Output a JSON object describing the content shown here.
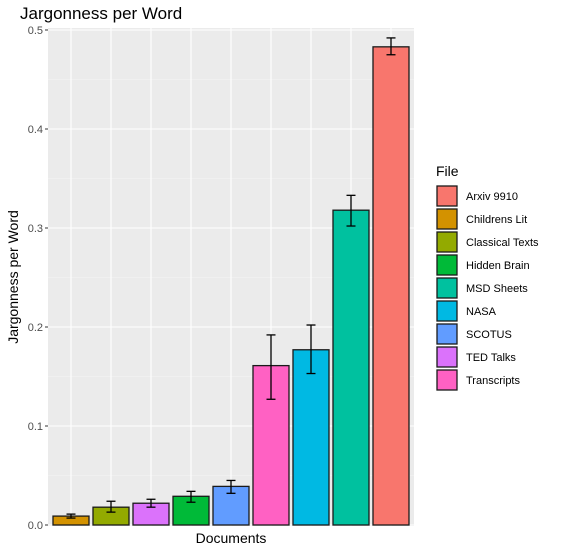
{
  "chart_data": {
    "type": "bar",
    "title": "Jargonness per Word",
    "xlabel": "Documents",
    "ylabel": "Jargonness per Word",
    "ylim": [
      0,
      0.5
    ],
    "y_ticks": [
      0.0,
      0.1,
      0.2,
      0.3,
      0.4,
      0.5
    ],
    "y_tick_labels": [
      "0.0",
      "0.1",
      "0.2",
      "0.3",
      "0.4",
      "0.5"
    ],
    "grid": true,
    "x_tick_labels_shown": false,
    "legend": {
      "title": "File",
      "placement": "right",
      "entries": [
        {
          "label": "Arxiv 9910",
          "color": "#F8766D"
        },
        {
          "label": "Childrens Lit",
          "color": "#D39200"
        },
        {
          "label": "Classical Texts",
          "color": "#93AA00"
        },
        {
          "label": "Hidden Brain",
          "color": "#00BA38"
        },
        {
          "label": "MSD Sheets",
          "color": "#00C19F"
        },
        {
          "label": "NASA",
          "color": "#00B9E3"
        },
        {
          "label": "SCOTUS",
          "color": "#619CFF"
        },
        {
          "label": "TED Talks",
          "color": "#DB72FB"
        },
        {
          "label": "Transcripts",
          "color": "#FF61C3"
        }
      ]
    },
    "categories": [
      "Childrens Lit",
      "Classical Texts",
      "TED Talks",
      "Hidden Brain",
      "SCOTUS",
      "Transcripts",
      "NASA",
      "MSD Sheets",
      "Arxiv 9910"
    ],
    "values": [
      0.009,
      0.018,
      0.022,
      0.029,
      0.039,
      0.161,
      0.177,
      0.318,
      0.483
    ],
    "error_low": [
      0.007,
      0.013,
      0.018,
      0.023,
      0.032,
      0.127,
      0.153,
      0.302,
      0.475
    ],
    "error_high": [
      0.011,
      0.024,
      0.026,
      0.034,
      0.045,
      0.192,
      0.202,
      0.333,
      0.492
    ],
    "colors": [
      "#D39200",
      "#93AA00",
      "#DB72FB",
      "#00BA38",
      "#619CFF",
      "#FF61C3",
      "#00B9E3",
      "#00C19F",
      "#F8766D"
    ]
  }
}
